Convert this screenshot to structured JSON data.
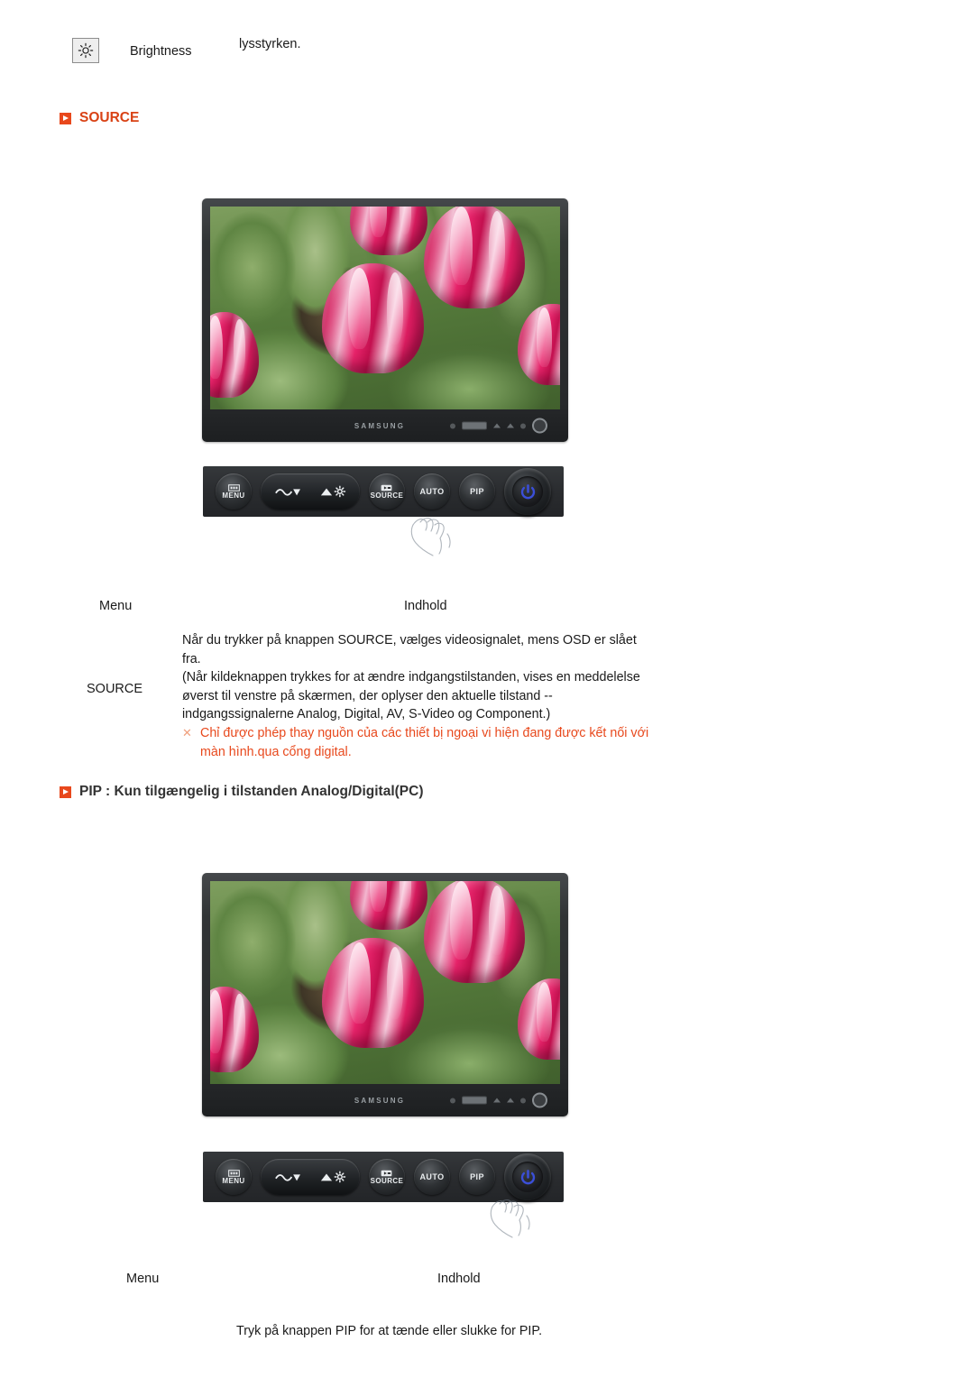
{
  "brightness_row": {
    "icon": "brightness-sun-icon",
    "label": "Brightness",
    "value": "lysstyrken."
  },
  "sections": {
    "source": {
      "heading": "SOURCE",
      "marker_color": "#e8481c",
      "heading_color": "#d94215"
    },
    "pip": {
      "heading": "PIP : Kun tilgængelig i tilstanden Analog/Digital(PC)",
      "marker_color": "#e8481c",
      "heading_color": "#333333"
    }
  },
  "monitor": {
    "brand": "SAMSUNG",
    "screen_content": "tulip-photo"
  },
  "control_panel": {
    "buttons": [
      {
        "name": "menu-button",
        "line1": "MENU",
        "icon": "osd-menu-icon"
      },
      {
        "name": "down-button",
        "line1": "",
        "icon": "nav-down-icon"
      },
      {
        "name": "up-button",
        "line1": "",
        "icon": "brightness-up-icon"
      },
      {
        "name": "source-button",
        "line1": "SOURCE",
        "icon": "source-icon"
      },
      {
        "name": "auto-button",
        "line1": "AUTO",
        "icon": ""
      },
      {
        "name": "pip-button",
        "line1": "PIP",
        "icon": ""
      },
      {
        "name": "power-button",
        "line1": "",
        "icon": "power-icon"
      }
    ],
    "power_led_color": "#3b4fd8"
  },
  "source_table": {
    "col_menu_header": "Menu",
    "col_indhold_header": "Indhold",
    "row_menu": "SOURCE",
    "paragraphs": [
      "Når du trykker på knappen SOURCE, vælges videosignalet, mens OSD er slået",
      "fra.",
      "(Når kildeknappen trykkes for at ændre indgangstilstanden, vises en meddelelse",
      "øverst til venstre på skærmen, der oplyser den aktuelle tilstand --",
      "indgangssignalerne Analog, Digital, AV, S-Video og Component.)"
    ],
    "note_marker": "✕",
    "note_lines": [
      "Chỉ được phép thay nguồn của các thiết bị ngoại vi hiện đang được kết nối với",
      "màn hình.qua cổng digital."
    ],
    "note_color": "#e8491d"
  },
  "pip_table": {
    "col_menu_header": "Menu",
    "col_indhold_header": "Indhold",
    "body_line": "Tryk på knappen PIP for at tænde eller slukke for PIP."
  }
}
